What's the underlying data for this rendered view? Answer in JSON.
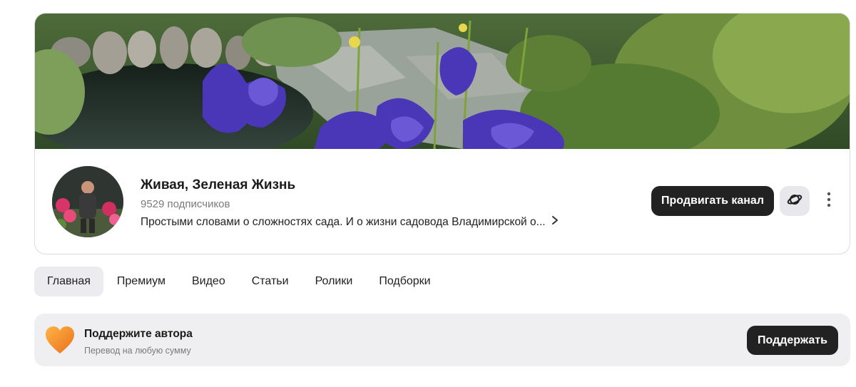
{
  "channel": {
    "name": "Живая, Зеленая Жизнь",
    "subscribers": "9529 подписчиков",
    "description": "Простыми словами о сложностях сада. И о жизни садовода Владимирской о...",
    "promote_label": "Продвигать канал"
  },
  "tabs": [
    {
      "label": "Главная",
      "active": true
    },
    {
      "label": "Премиум"
    },
    {
      "label": "Видео"
    },
    {
      "label": "Статьи"
    },
    {
      "label": "Ролики"
    },
    {
      "label": "Подборки"
    }
  ],
  "support": {
    "title": "Поддержите автора",
    "subtitle": "Перевод на любую сумму",
    "button_label": "Поддержать"
  },
  "colors": {
    "accent_dark": "#222222",
    "heart": "#f08a24"
  },
  "icons": [
    "planet-icon",
    "more-vertical-icon",
    "chevron-right-icon",
    "heart-icon"
  ]
}
